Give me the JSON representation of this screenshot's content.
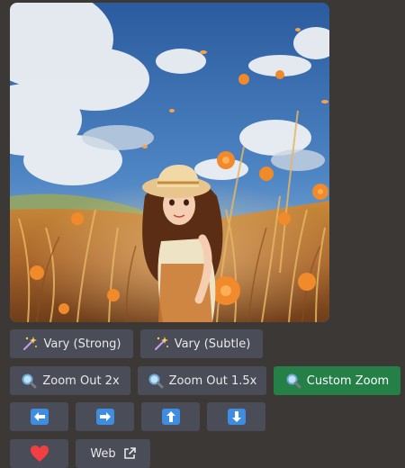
{
  "image": {
    "alt": "Anime-style illustration of a smiling girl in a straw hat standing in a golden wheat field with orange flowers under a blue cloudy sky"
  },
  "rows": {
    "vary": {
      "strong": {
        "label": "Vary (Strong)",
        "icon": "magic-wand-icon"
      },
      "subtle": {
        "label": "Vary (Subtle)",
        "icon": "magic-wand-icon"
      }
    },
    "zoom": {
      "out2": {
        "label": "Zoom Out 2x",
        "icon": "magnifier-icon"
      },
      "out15": {
        "label": "Zoom Out 1.5x",
        "icon": "magnifier-icon"
      },
      "custom": {
        "label": "Custom Zoom",
        "icon": "magnifier-icon"
      }
    },
    "pan": {
      "left": {
        "icon": "arrow-left-icon"
      },
      "right": {
        "icon": "arrow-right-icon"
      },
      "up": {
        "icon": "arrow-up-icon"
      },
      "down": {
        "icon": "arrow-down-icon"
      }
    },
    "misc": {
      "favorite": {
        "icon": "heart-icon"
      },
      "web": {
        "label": "Web",
        "icon": "external-link-icon"
      }
    }
  },
  "colors": {
    "background": "#3b3836",
    "button": "#4a4d57",
    "primary_button": "#248046",
    "arrow_icon": "#3e8de0",
    "heart": "#f23f43"
  }
}
